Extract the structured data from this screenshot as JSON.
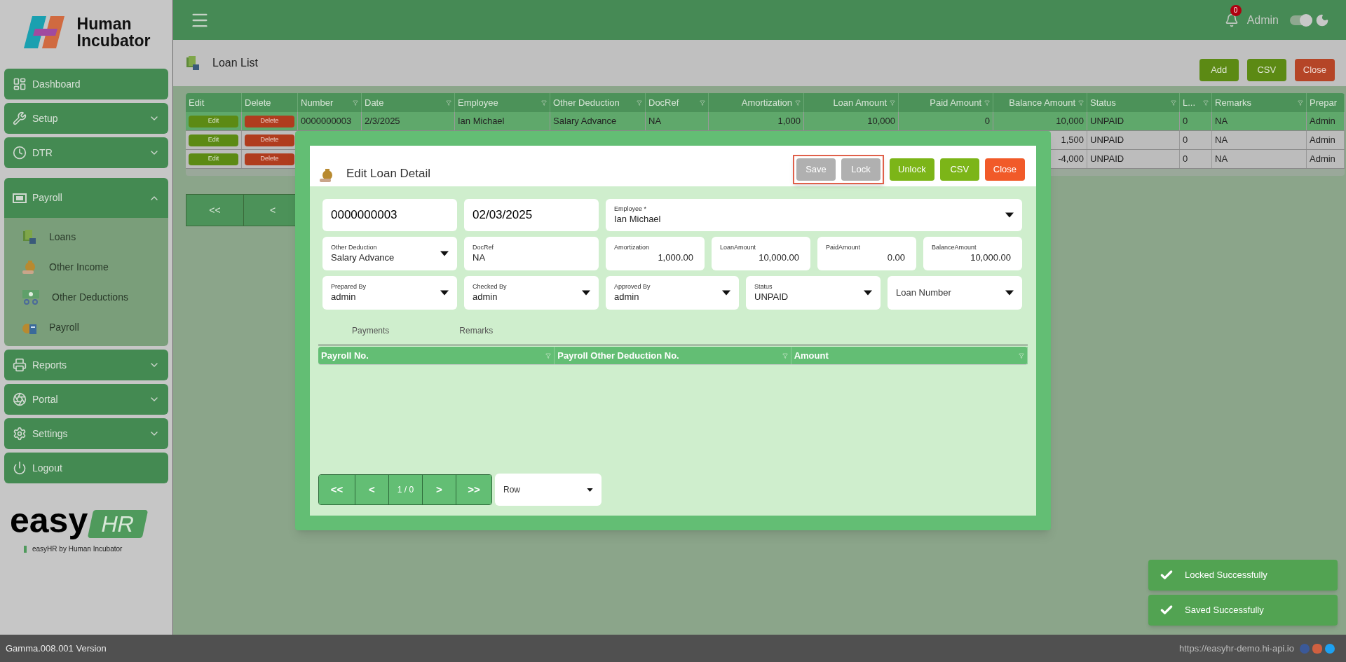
{
  "brand": {
    "line1": "Human",
    "line2": "Incubator"
  },
  "sidebar": {
    "items": [
      {
        "label": "Dashboard",
        "expandable": false,
        "expanded": false
      },
      {
        "label": "Setup",
        "expandable": true,
        "expanded": false
      },
      {
        "label": "DTR",
        "expandable": true,
        "expanded": false
      },
      {
        "label": "Payroll",
        "expandable": true,
        "expanded": true,
        "children": [
          {
            "label": "Loans"
          },
          {
            "label": "Other Income"
          },
          {
            "label": "Other Deductions"
          },
          {
            "label": "Payroll"
          }
        ]
      },
      {
        "label": "Reports",
        "expandable": true,
        "expanded": false
      },
      {
        "label": "Portal",
        "expandable": true,
        "expanded": false
      },
      {
        "label": "Settings",
        "expandable": true,
        "expanded": false
      },
      {
        "label": "Logout",
        "expandable": false,
        "expanded": false
      }
    ]
  },
  "footer_logo": {
    "word": "easy",
    "tag": "HR",
    "caption": "easyHR by Human Incubator"
  },
  "version": "Gamma.008.001 Version",
  "topbar": {
    "notifications": "0",
    "user": "Admin",
    "theme_toggle": {
      "on": true
    }
  },
  "page": {
    "title": "Loan List",
    "buttons": [
      {
        "label": "Add",
        "kind": "green"
      },
      {
        "label": "CSV",
        "kind": "green"
      },
      {
        "label": "Close",
        "kind": "red"
      }
    ]
  },
  "table": {
    "columns": [
      "Edit",
      "Delete",
      "Number",
      "Date",
      "Employee",
      "Other Deduction",
      "DocRef",
      "Amortization",
      "Loan Amount",
      "Paid Amount",
      "Balance Amount",
      "Status",
      "L...",
      "Remarks",
      "Prepar"
    ],
    "rows": [
      {
        "selected": true,
        "cells": [
          "Edit",
          "Delete",
          "0000000003",
          "2/3/2025",
          "Ian Michael",
          "Salary Advance",
          "NA",
          "1,000",
          "10,000",
          "0",
          "10,000",
          "UNPAID",
          "0",
          "NA",
          "Admin"
        ]
      },
      {
        "selected": false,
        "cells": [
          "Edit",
          "Delete",
          null,
          null,
          null,
          null,
          null,
          null,
          null,
          null,
          "1,500",
          "UNPAID",
          "0",
          "NA",
          "Admin"
        ]
      },
      {
        "selected": false,
        "cells": [
          "Edit",
          "Delete",
          null,
          null,
          null,
          null,
          null,
          null,
          null,
          null,
          "-4,000",
          "UNPAID",
          "0",
          "NA",
          "Admin"
        ]
      }
    ]
  },
  "pager": {
    "first": "<<",
    "prev": "<"
  },
  "modal": {
    "title": "Edit Loan Detail",
    "buttons": [
      {
        "label": "Save",
        "kind": "green",
        "disabled": true,
        "highlighted": true
      },
      {
        "label": "Lock",
        "kind": "green",
        "disabled": true,
        "highlighted": true
      },
      {
        "label": "Unlock",
        "kind": "green",
        "disabled": false,
        "highlighted": false
      },
      {
        "label": "CSV",
        "kind": "green",
        "disabled": false,
        "highlighted": false
      },
      {
        "label": "Close",
        "kind": "red",
        "disabled": false,
        "highlighted": false
      }
    ],
    "field_rows": [
      [
        {
          "kind": "big",
          "value": "0000000003"
        },
        {
          "kind": "big",
          "value": "02/03/2025"
        },
        {
          "kind": "select",
          "label": "Employee *",
          "value": "Ian  Michael"
        }
      ],
      [
        {
          "kind": "select",
          "label": "Other Deduction",
          "value": "Salary Advance"
        },
        {
          "kind": "text",
          "label": "DocRef",
          "value": "NA"
        },
        {
          "kind": "number",
          "label": "Amortization",
          "value": "1,000.00"
        },
        {
          "kind": "number",
          "label": "LoanAmount",
          "value": "10,000.00"
        },
        {
          "kind": "number",
          "label": "PaidAmount",
          "value": "0.00"
        },
        {
          "kind": "number",
          "label": "BalanceAmount",
          "value": "10,000.00"
        }
      ],
      [
        {
          "kind": "select",
          "label": "Prepared By",
          "value": "admin"
        },
        {
          "kind": "select",
          "label": "Checked By",
          "value": "admin"
        },
        {
          "kind": "select",
          "label": "Approved By",
          "value": "admin"
        },
        {
          "kind": "select",
          "label": "Status",
          "value": "UNPAID"
        },
        {
          "kind": "select",
          "placeholder": "Loan Number"
        }
      ]
    ],
    "tabs": [
      "Payments",
      "Remarks"
    ],
    "grid_columns": [
      "Payroll No.",
      "Payroll Other Deduction No.",
      "Amount"
    ],
    "pager": {
      "first": "<<",
      "prev": "<",
      "page": "1 / 0",
      "next": ">",
      "last": ">>",
      "rows": {
        "placeholder": "Row"
      }
    }
  },
  "toasts": [
    "Locked Successfully",
    "Saved Successfully"
  ],
  "status_bar": {
    "url": "https://easyhr-demo.hi-api.io"
  }
}
